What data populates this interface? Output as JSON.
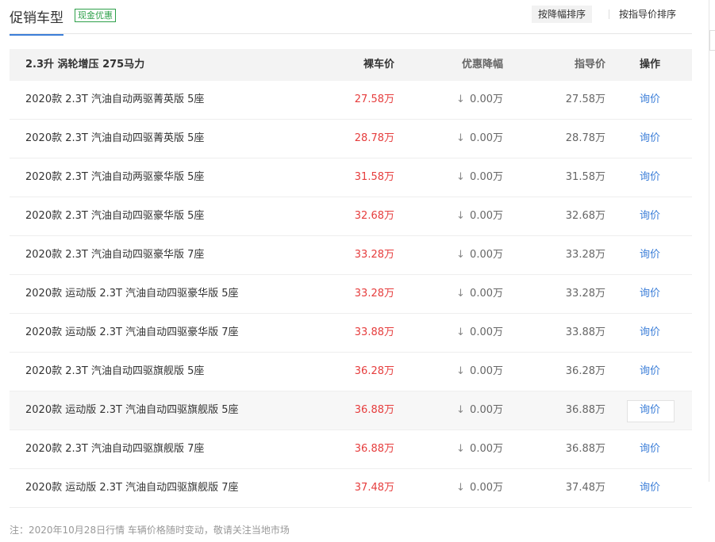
{
  "header": {
    "title": "促销车型",
    "badge": "现金优惠",
    "sort_discount": "按降幅排序",
    "sort_guide": "按指导价排序"
  },
  "table": {
    "group_label": "2.3升 涡轮增压 275马力",
    "col_price": "裸车价",
    "col_discount": "优惠降幅",
    "col_guide": "指导价",
    "col_op": "操作",
    "rows": [
      {
        "name": "2020款 2.3T 汽油自动两驱菁英版 5座",
        "price": "27.58万",
        "discount": "0.00万",
        "guide": "27.58万",
        "op": "询价"
      },
      {
        "name": "2020款 2.3T 汽油自动四驱菁英版 5座",
        "price": "28.78万",
        "discount": "0.00万",
        "guide": "28.78万",
        "op": "询价"
      },
      {
        "name": "2020款 2.3T 汽油自动两驱豪华版 5座",
        "price": "31.58万",
        "discount": "0.00万",
        "guide": "31.58万",
        "op": "询价"
      },
      {
        "name": "2020款 2.3T 汽油自动四驱豪华版 5座",
        "price": "32.68万",
        "discount": "0.00万",
        "guide": "32.68万",
        "op": "询价"
      },
      {
        "name": "2020款 2.3T 汽油自动四驱豪华版 7座",
        "price": "33.28万",
        "discount": "0.00万",
        "guide": "33.28万",
        "op": "询价"
      },
      {
        "name": "2020款 运动版 2.3T 汽油自动四驱豪华版 5座",
        "price": "33.28万",
        "discount": "0.00万",
        "guide": "33.28万",
        "op": "询价"
      },
      {
        "name": "2020款 运动版 2.3T 汽油自动四驱豪华版 7座",
        "price": "33.88万",
        "discount": "0.00万",
        "guide": "33.88万",
        "op": "询价"
      },
      {
        "name": "2020款 2.3T 汽油自动四驱旗舰版 5座",
        "price": "36.28万",
        "discount": "0.00万",
        "guide": "36.28万",
        "op": "询价"
      },
      {
        "name": "2020款 运动版 2.3T 汽油自动四驱旗舰版 5座",
        "price": "36.88万",
        "discount": "0.00万",
        "guide": "36.88万",
        "op": "询价",
        "highlighted": true
      },
      {
        "name": "2020款 2.3T 汽油自动四驱旗舰版 7座",
        "price": "36.88万",
        "discount": "0.00万",
        "guide": "36.88万",
        "op": "询价"
      },
      {
        "name": "2020款 运动版 2.3T 汽油自动四驱旗舰版 7座",
        "price": "37.48万",
        "discount": "0.00万",
        "guide": "37.48万",
        "op": "询价"
      }
    ]
  },
  "note": "注：2020年10月28日行情 车辆价格随时变动，敬请关注当地市场",
  "icons": {
    "discount_arrow": "arrow-down-icon"
  },
  "colors": {
    "price": "#e63d3d",
    "link": "#3b7ed8",
    "badge": "#2ea04a"
  }
}
